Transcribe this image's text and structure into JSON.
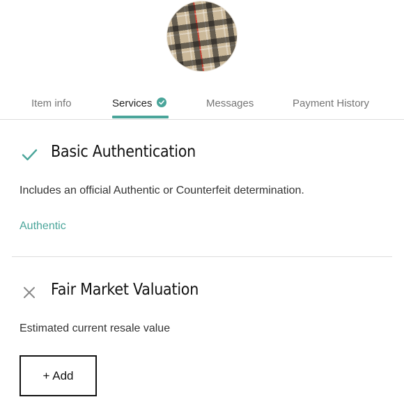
{
  "item": {
    "avatar_icon": "plaid-cap-photo"
  },
  "tabs": [
    {
      "label": "Item info",
      "active": false
    },
    {
      "label": "Services",
      "active": true,
      "badge_icon": "check-circle-icon"
    },
    {
      "label": "Messages",
      "active": false
    },
    {
      "label": "Payment History",
      "active": false
    }
  ],
  "services": [
    {
      "status_icon": "check-icon",
      "title": "Basic Authentication",
      "description": "Includes an official Authentic or Counterfeit determination.",
      "result": "Authentic"
    },
    {
      "status_icon": "close-icon",
      "title": "Fair Market Valuation",
      "description": "Estimated current resale value",
      "action_label": "+ Add"
    }
  ],
  "colors": {
    "accent": "#4aa59a",
    "divider": "#dcdcdc",
    "text": "#222222",
    "muted": "#757575"
  }
}
